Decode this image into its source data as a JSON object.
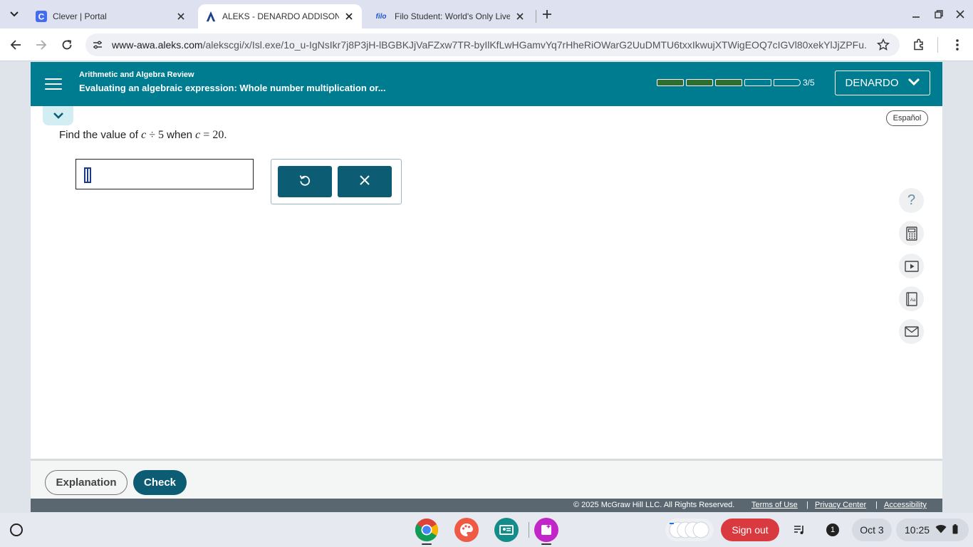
{
  "browser": {
    "tabs": [
      {
        "title": "Clever | Portal",
        "favicon": "clever-logo",
        "active": false
      },
      {
        "title": "ALEKS - DENARDO ADDISON - L",
        "favicon": "aleks-logo",
        "active": true
      },
      {
        "title": "Filo Student: World's Only Live I",
        "favicon": "filo-logo",
        "favicon_text": "filo",
        "active": false
      }
    ],
    "url_host": "www-awa.aleks.com",
    "url_path": "/alekscgi/x/Isl.exe/1o_u-IgNsIkr7j8P3jH-lBGBKJjVaFZxw7TR-byIlKfLwHGamvYq7rHheRiOWarG2UuDMTU6txxIkwujXTWigEOQ7cIGVl80xekYlJjZPFu..."
  },
  "header": {
    "course": "Arithmetic and Algebra Review",
    "topic": "Evaluating an algebraic expression: Whole number multiplication or...",
    "progress": {
      "completed": 3,
      "total": 5,
      "label": "3/5"
    },
    "user_name": "DENARDO"
  },
  "language_button": "Español",
  "question": {
    "prefix": "Find the value of",
    "expr_var": "c",
    "expr_op": "÷",
    "expr_num": "5",
    "middle": "when",
    "cond_var": "c",
    "cond_eq": "=",
    "cond_num": "20",
    "suffix": "."
  },
  "answer": {
    "value": ""
  },
  "side_tools": [
    "help-icon",
    "calculator-icon",
    "video-icon",
    "dictionary-icon",
    "mail-icon"
  ],
  "side_help_glyph": "?",
  "footer": {
    "explanation_label": "Explanation",
    "check_label": "Check"
  },
  "legal": {
    "copyright": "© 2025 McGraw Hill LLC. All Rights Reserved.",
    "terms": "Terms of Use",
    "privacy": "Privacy Center",
    "accessibility": "Accessibility",
    "separator": "|"
  },
  "shelf": {
    "apps": [
      "chrome-icon",
      "paint-icon",
      "classroom-icon",
      "notes-icon"
    ],
    "sign_out": "Sign out",
    "notification_count": "1",
    "date": "Oct 3",
    "time": "10:25"
  },
  "colors": {
    "aleks_teal": "#007c91",
    "button_teal": "#0c5c73",
    "progress_green": "#2f6e2f",
    "sign_out_red": "#d93a3f"
  }
}
